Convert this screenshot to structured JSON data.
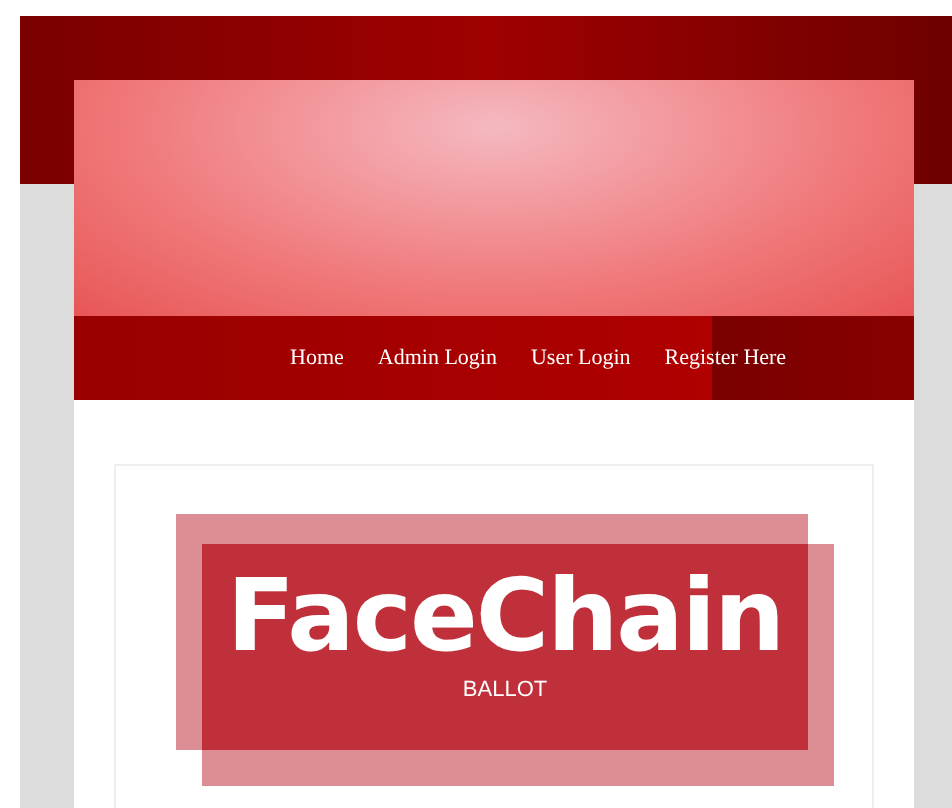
{
  "nav": {
    "items": [
      {
        "label": "Home"
      },
      {
        "label": "Admin Login"
      },
      {
        "label": "User Login"
      },
      {
        "label": "Register Here"
      }
    ]
  },
  "logo": {
    "title": "FaceChain",
    "subtitle": "BALLOT"
  }
}
